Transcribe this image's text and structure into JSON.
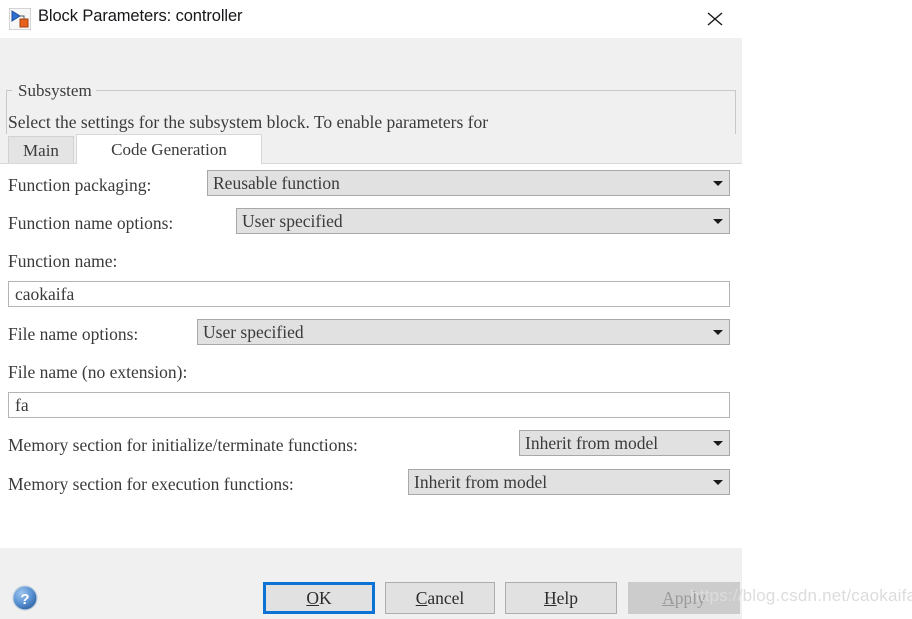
{
  "window": {
    "title": "Block Parameters: controller",
    "icon": "simulink-block-icon",
    "close_icon": "close-icon"
  },
  "description": {
    "group_label": "Subsystem",
    "text": "Select the settings for the subsystem block. To enable parameters for\ncode generation, select 'Treat as atomic unit'."
  },
  "tabs": [
    {
      "label": "Main",
      "active": false
    },
    {
      "label": "Code Generation",
      "active": true
    }
  ],
  "fields": {
    "function_packaging": {
      "label": "Function packaging:",
      "value": "Reusable function"
    },
    "function_name_options": {
      "label": "Function name options:",
      "value": "User specified"
    },
    "function_name": {
      "label": "Function name:",
      "value": "caokaifa"
    },
    "file_name_options": {
      "label": "File name options:",
      "value": "User specified"
    },
    "file_name": {
      "label": "File name (no extension):",
      "value": "fa"
    },
    "memory_section_init": {
      "label": "Memory section for initialize/terminate functions:",
      "value": "Inherit from model"
    },
    "memory_section_exec": {
      "label": "Memory section for execution functions:",
      "value": "Inherit from model"
    }
  },
  "footer": {
    "help_icon": "help-circle-icon",
    "buttons": {
      "ok": {
        "prefix": "",
        "mnemonic": "O",
        "suffix": "K",
        "state": "focused"
      },
      "cancel": {
        "prefix": "",
        "mnemonic": "C",
        "suffix": "ancel",
        "state": "normal"
      },
      "help": {
        "prefix": "",
        "mnemonic": "H",
        "suffix": "elp",
        "state": "normal"
      },
      "apply": {
        "prefix": "",
        "mnemonic": "A",
        "suffix": "pply",
        "state": "disabled"
      }
    }
  },
  "watermark": {
    "text": "https://blog.csdn.net/caokaifa"
  },
  "colors": {
    "dialog_bg": "#f0f0f0",
    "content_bg": "#ffffff",
    "combo_bg": "#e1e1e1",
    "focus_blue": "#0a73d4",
    "text": "#3b3b3b",
    "disabled_bg": "#cccccc"
  }
}
